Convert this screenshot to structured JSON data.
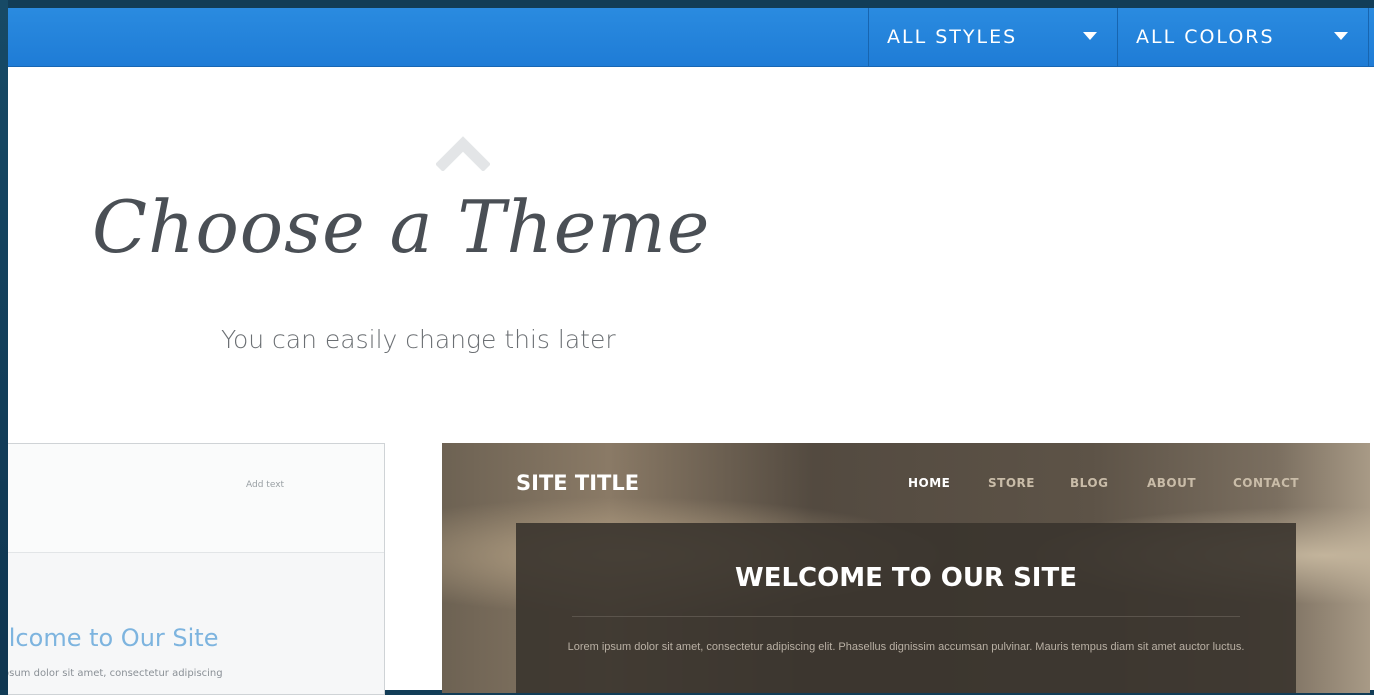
{
  "filters": {
    "styles_label": "ALL STYLES",
    "colors_label": "ALL COLORS"
  },
  "header": {
    "title": "Choose a Theme",
    "subtitle": "You can easily change this later"
  },
  "theme_left": {
    "add_text": "Add text",
    "welcome": "elcome to Our Site",
    "lorem": "ipsum dolor sit amet, consectetur adipiscing"
  },
  "theme_right": {
    "site_title": "SITE TITLE",
    "nav": [
      "HOME",
      "STORE",
      "BLOG",
      "ABOUT",
      "CONTACT"
    ],
    "hero_title": "WELCOME TO OUR SITE",
    "hero_text": "Lorem ipsum dolor sit amet, consectetur adipiscing elit. Phasellus dignissim accumsan pulvinar. Mauris tempus diam sit amet auctor luctus."
  },
  "colors": {
    "topbar": "#2383dc",
    "title": "#4a4f55",
    "accent_left": "#7db4df"
  }
}
